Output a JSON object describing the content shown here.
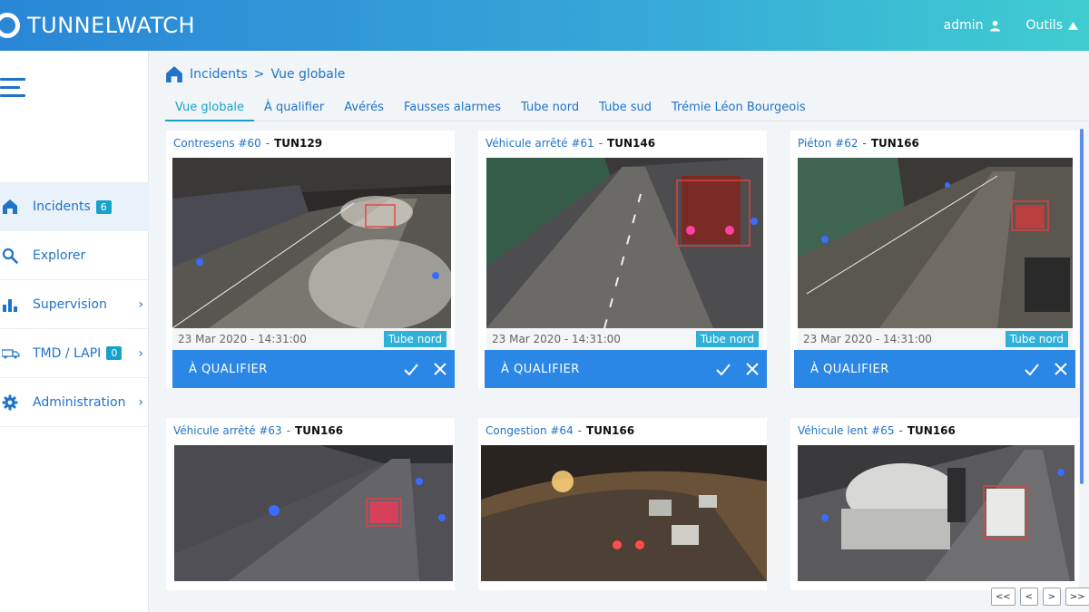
{
  "header": {
    "app_name": "TUNNELWATCH",
    "user_label": "admin",
    "tools_label": "Outils"
  },
  "sidebar": {
    "items": [
      {
        "label": "Incidents",
        "badge": "6",
        "icon": "home-icon"
      },
      {
        "label": "Explorer",
        "icon": "search-icon"
      },
      {
        "label": "Supervision",
        "icon": "bar-chart-icon"
      },
      {
        "label": "TMD / LAPI",
        "badge": "0",
        "icon": "truck-icon"
      },
      {
        "label": "Administration",
        "icon": "gear-icon"
      }
    ]
  },
  "breadcrumb": {
    "root": "Incidents",
    "separator": ">",
    "current": "Vue globale"
  },
  "tabs": [
    "Vue globale",
    "À qualifier",
    "Avérés",
    "Fausses alarmes",
    "Tube nord",
    "Tube sud",
    "Trémie Léon Bourgeois"
  ],
  "cards": [
    {
      "type": "Contresens #60",
      "tunnel": "TUN129",
      "timestamp": "23 Mar 2020 - 14:31:00",
      "location": "Tube nord",
      "action_label": "À QUALIFIER"
    },
    {
      "type": "Véhicule arrêté #61",
      "tunnel": "TUN146",
      "timestamp": "23 Mar 2020 - 14:31:00",
      "location": "Tube nord",
      "action_label": "À QUALIFIER"
    },
    {
      "type": "Piéton #62",
      "tunnel": "TUN166",
      "timestamp": "23 Mar 2020 - 14:31:00",
      "location": "Tube nord",
      "action_label": "À QUALIFIER"
    },
    {
      "type": "Véhicule arrêté #63",
      "tunnel": "TUN166"
    },
    {
      "type": "Congestion #64",
      "tunnel": "TUN166"
    },
    {
      "type": "Véhicule lent #65",
      "tunnel": "TUN166"
    }
  ],
  "pagination": {
    "first": "<<",
    "prev": "<",
    "next": ">",
    "last": ">>"
  },
  "colors": {
    "primary": "#1f73c9",
    "action_bar": "#2a87e6",
    "badge": "#17a3c9"
  }
}
